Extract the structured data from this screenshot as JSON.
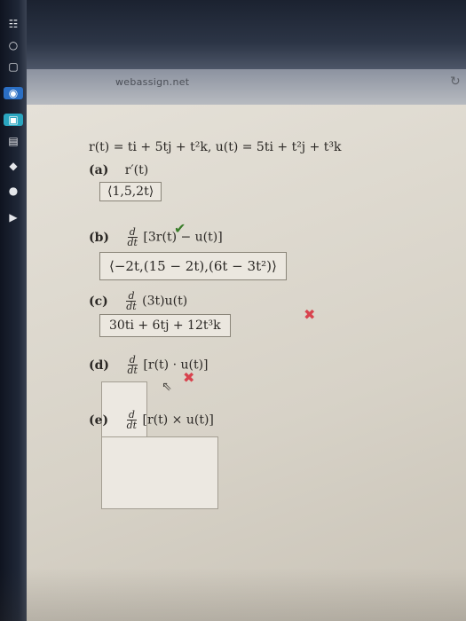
{
  "browser": {
    "url": "webassign.net",
    "reload_icon": "↻"
  },
  "dock_icons": [
    "☷",
    "○",
    "▢",
    "◉",
    "▣",
    "▤",
    "◆",
    "●",
    "▶"
  ],
  "problem": {
    "statement": "r(t) = ti + 5tj + t²k,  u(t) = 5ti + t²j + t³k"
  },
  "parts": [
    {
      "label": "(a)",
      "prompt": "r′(t)",
      "answer": "⟨1,5,2t⟩",
      "status": "correct"
    },
    {
      "label": "(b)",
      "prompt_frac_num": "d",
      "prompt_frac_den": "dt",
      "prompt": "[3r(t) − u(t)]",
      "answer": "⟨−2t,(15 − 2t),(6t − 3t²)⟩",
      "status": "incorrect"
    },
    {
      "label": "(c)",
      "prompt_frac_num": "d",
      "prompt_frac_den": "dt",
      "prompt": "(3t)u(t)",
      "answer": "30ti + 6tj + 12t³k",
      "status": "incorrect"
    },
    {
      "label": "(d)",
      "prompt_frac_num": "d",
      "prompt_frac_den": "dt",
      "prompt": "[r(t) · u(t)]",
      "answer": "",
      "status": ""
    },
    {
      "label": "(e)",
      "prompt_frac_num": "d",
      "prompt_frac_den": "dt",
      "prompt": "[r(t) × u(t)]",
      "answer": "",
      "status": ""
    }
  ],
  "status_icons": {
    "correct": "✔",
    "incorrect": "✖",
    "cursor": "⇖"
  },
  "colors": {
    "correct": "#3a7d2a",
    "incorrect": "#d8434e"
  }
}
